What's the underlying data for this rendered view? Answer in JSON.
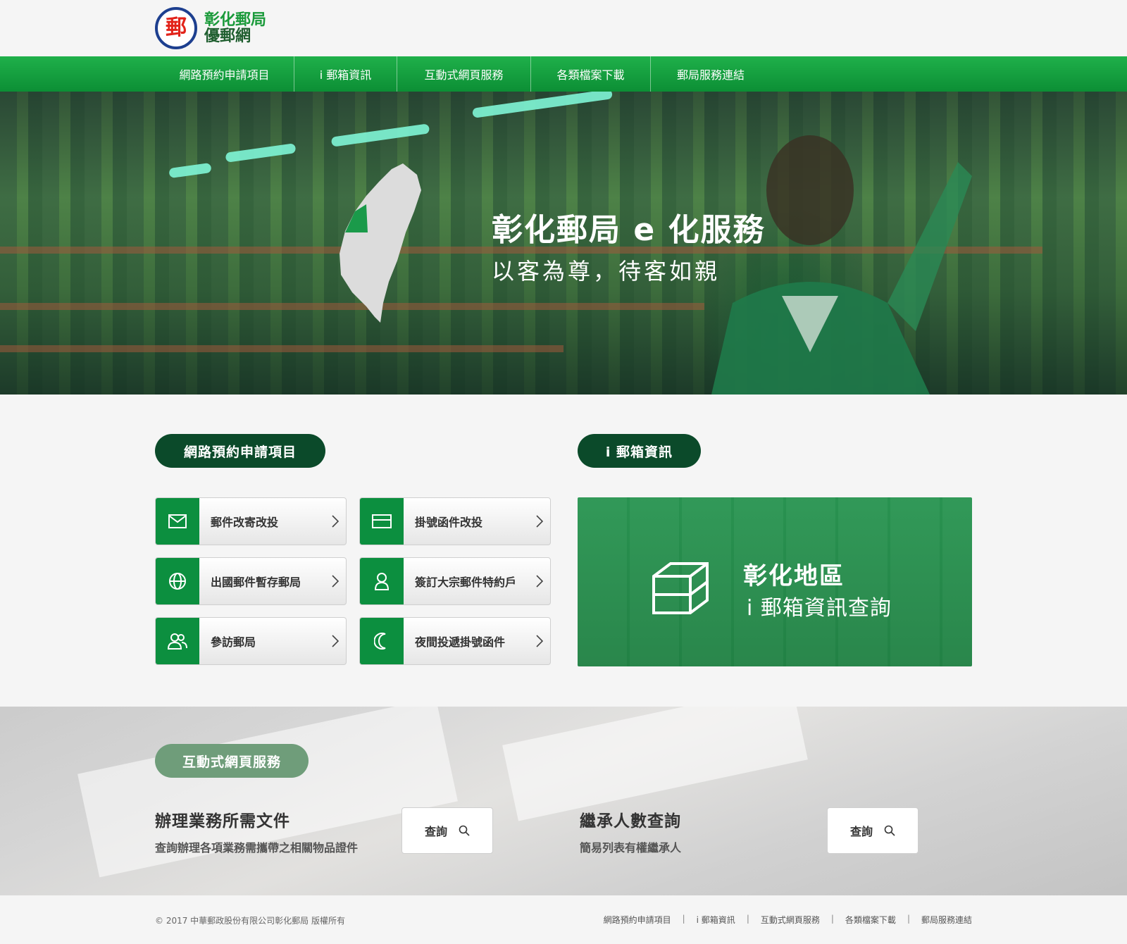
{
  "header": {
    "logo_glyph": "郵",
    "logo_line1": "彰化郵局",
    "logo_line2": "優郵網"
  },
  "nav": [
    {
      "label": "網路預約申請項目"
    },
    {
      "label": "i 郵箱資訊"
    },
    {
      "label": "互動式網頁服務"
    },
    {
      "label": "各類檔案下載"
    },
    {
      "label": "郵局服務連結"
    }
  ],
  "hero": {
    "title": "彰化郵局 e 化服務",
    "subtitle": "以客為尊，待客如親"
  },
  "online_section": {
    "heading": "網路預約申請項目",
    "items": [
      {
        "label": "郵件改寄改投",
        "icon": "envelope-icon"
      },
      {
        "label": "掛號函件改投",
        "icon": "card-icon"
      },
      {
        "label": "出國郵件暫存郵局",
        "icon": "globe-icon"
      },
      {
        "label": "簽訂大宗郵件特約戶",
        "icon": "user-icon"
      },
      {
        "label": "參訪郵局",
        "icon": "users-icon"
      },
      {
        "label": "夜間投遞掛號函件",
        "icon": "moon-icon"
      }
    ]
  },
  "ibox_section": {
    "heading": "i 郵箱資訊",
    "banner_line1": "彰化地區",
    "banner_line2": "i 郵箱資訊查詢"
  },
  "interactive_section": {
    "heading": "互動式網頁服務",
    "queries": [
      {
        "title": "辦理業務所需文件",
        "desc": "查詢辦理各項業務需攜帶之相關物品證件",
        "button": "查詢"
      },
      {
        "title": "繼承人數查詢",
        "desc": "簡易列表有權繼承人",
        "button": "查詢"
      }
    ]
  },
  "footer": {
    "copyright": "© 2017 中華郵政股份有限公司彰化郵局 版權所有",
    "links": [
      "網路預約申請項目",
      "i 郵箱資訊",
      "互動式網頁服務",
      "各類檔案下載",
      "郵局服務連結"
    ],
    "separator": "|"
  },
  "colors": {
    "brand_green": "#0c8f3f",
    "dark_green": "#0b4a2a",
    "muted_green": "#6f9d7a",
    "logo_red": "#e2231a",
    "logo_blue": "#1d3f8f"
  }
}
